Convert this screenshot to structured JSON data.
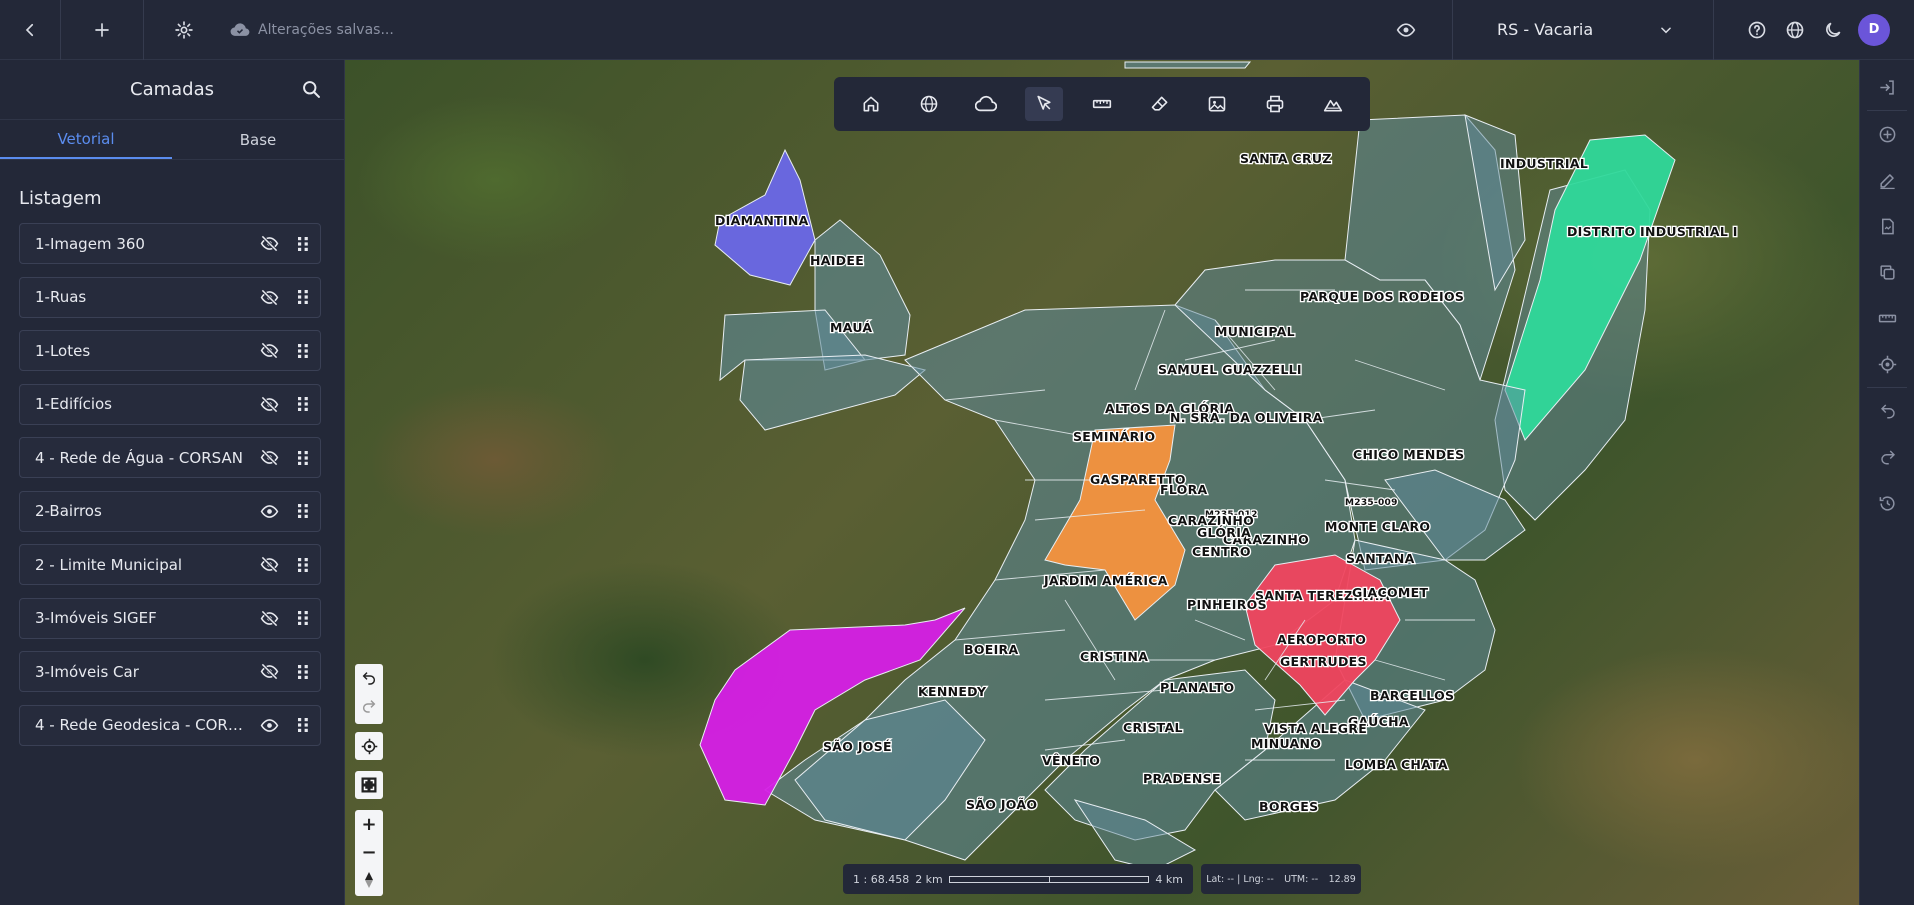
{
  "topbar": {
    "save_status": "Alterações salvas...",
    "region": "RS - Vacaria",
    "avatar_initial": "D",
    "icons": [
      "back-icon",
      "plus-icon",
      "gear-icon",
      "cloud-check-icon",
      "eye-icon",
      "chevron-down-icon",
      "help-icon",
      "globe-icon",
      "moon-icon"
    ]
  },
  "sidebar": {
    "title": "Camadas",
    "tabs": [
      {
        "label": "Vetorial",
        "active": true
      },
      {
        "label": "Base",
        "active": false
      }
    ],
    "list_title": "Listagem",
    "layers": [
      {
        "name": "1-Imagem 360",
        "visible": false
      },
      {
        "name": "1-Ruas",
        "visible": false
      },
      {
        "name": "1-Lotes",
        "visible": false
      },
      {
        "name": "1-Edifícios",
        "visible": false
      },
      {
        "name": "4 - Rede de Água - CORSAN",
        "visible": false
      },
      {
        "name": "2-Bairros",
        "visible": true
      },
      {
        "name": "2 - Limite Municipal",
        "visible": false
      },
      {
        "name": "3-Imóveis SIGEF",
        "visible": false
      },
      {
        "name": "3-Imóveis Car",
        "visible": false
      },
      {
        "name": "4 - Rede Geodesica - CORSAN",
        "visible": true
      }
    ]
  },
  "map": {
    "neighborhoods": [
      "SANTA CRUZ",
      "INDUSTRIAL",
      "DISTRITO INDUSTRIAL I",
      "DIAMANTINA",
      "HAIDEE",
      "MAUÁ",
      "PARQUE  DOS  RODEIOS",
      "MUNICIPAL",
      "SAMUEL GUAZZELLI",
      "ALTOS DA GLÓRIA",
      "N. SRA. DA OLIVEIRA",
      "SEMINÁRIO",
      "CHICO MENDES",
      "GASPARETTO",
      "FLORA",
      "M235-009",
      "M235-012",
      "CARAZINHO",
      "CARAZINHO",
      "MONTE CLARO",
      "GLÓRIA",
      "CENTRO",
      "SANTANA",
      "JARDIM AMÉRICA",
      "SANTA TEREZINHA",
      "GIACOMET",
      "PINHEIROS",
      "AEROPORTO",
      "BOEIRA",
      "CRISTINA",
      "GERTRUDES",
      "KENNEDY",
      "PLANALTO",
      "GAÚCHA",
      "BARCELLOS",
      "CRISTAL",
      "VISTA ALEGRE",
      "SÃO JOSÉ",
      "MINUANO",
      "VÊNETO",
      "LOMBA CHATA",
      "PRADENSE",
      "SÃO JOÃO",
      "BORGES"
    ],
    "colors": {
      "diamantina": "#6a68e8",
      "industrial": "#2fd89a",
      "centro": "#f5923e",
      "aeroporto": "#f0455f",
      "sao_jose": "#d61fe6",
      "districts": "#5f8a9a"
    }
  },
  "toolbar": {
    "tools": [
      "home-icon",
      "globe-icon",
      "cloud-icon",
      "pointer-icon",
      "ruler-icon",
      "eraser-icon",
      "image-icon",
      "printer-icon",
      "terrain-icon"
    ],
    "active": "pointer-icon"
  },
  "scale": {
    "ratio": "1 : 68.458",
    "left_label": "2 km",
    "right_label": "4 km"
  },
  "coords": {
    "lat_lng": "Lat: -- | Lng: --",
    "utm": "UTM: --",
    "zoom": "12.89"
  },
  "rightbar": {
    "tools": [
      "login-icon",
      "add-circle-icon",
      "edit-icon",
      "document-icon",
      "copy-icon",
      "ruler-icon",
      "target-icon",
      "undo-icon",
      "redo-icon",
      "history-icon"
    ]
  }
}
